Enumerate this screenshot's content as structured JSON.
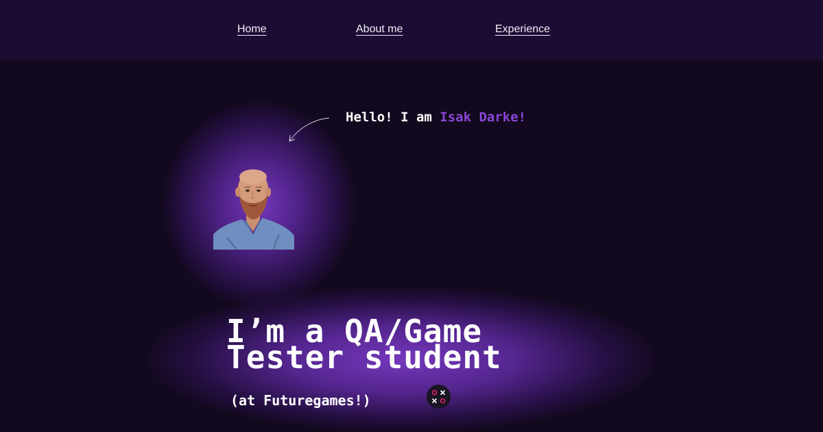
{
  "nav": {
    "items": [
      {
        "label": "Home"
      },
      {
        "label": "About me"
      },
      {
        "label": "Experience"
      }
    ]
  },
  "hero": {
    "greeting_prefix": "Hello! I am ",
    "greeting_name": "Isak Darke!",
    "headline_line1": "I’m a QA/Game",
    "headline_line2": "Tester student",
    "subline": "(at Futuregames!)",
    "portrait_icon": "portrait-photo",
    "arrow_icon": "curved-arrow-icon",
    "school_logo_icon": "futuregames-logo-icon"
  },
  "colors": {
    "background": "#13091f",
    "navbar": "#1c0c33",
    "accent": "#8a46d6",
    "glow": "#7a3ac4"
  }
}
